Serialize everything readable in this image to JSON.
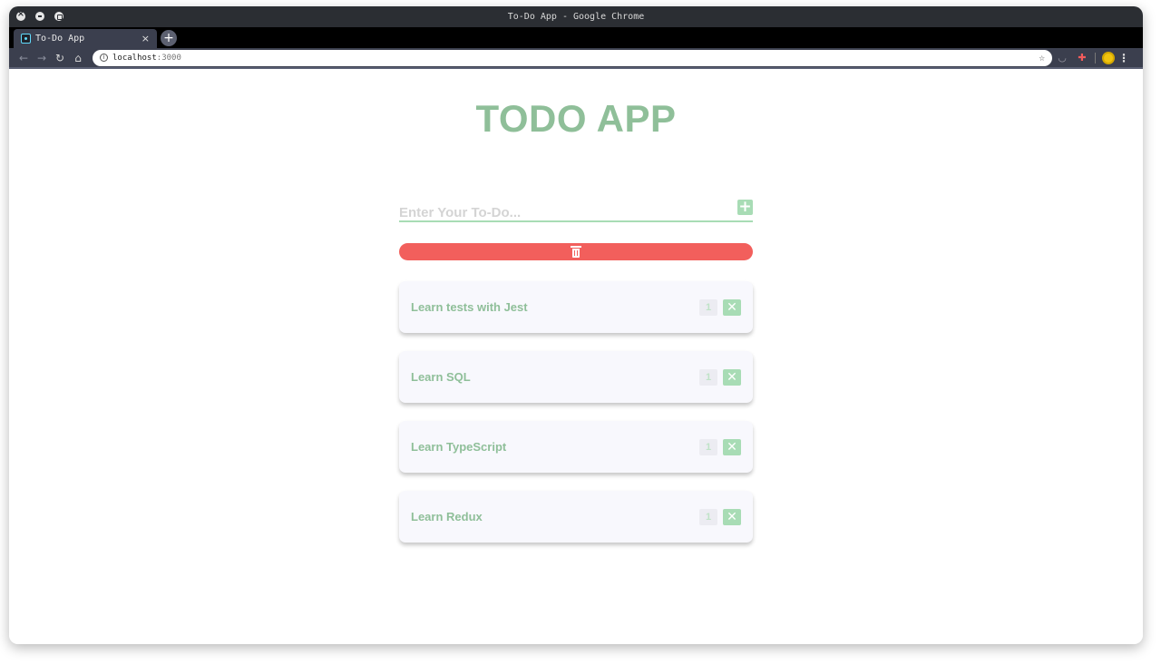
{
  "browser": {
    "window_title": "To-Do App - Google Chrome",
    "tab_title": "To-Do App",
    "url_host": "localhost",
    "url_port": ":3000"
  },
  "app": {
    "title": "TODO APP",
    "input_placeholder": "Enter Your To-Do...",
    "add_icon": "plus-icon",
    "clear_icon": "trash-icon"
  },
  "todos": [
    {
      "text": "Learn tests with Jest",
      "count": "1"
    },
    {
      "text": "Learn SQL",
      "count": "1"
    },
    {
      "text": "Learn TypeScript",
      "count": "1"
    },
    {
      "text": "Learn Redux",
      "count": "1"
    }
  ],
  "colors": {
    "accent": "#8fbf99",
    "accent_light": "#a8dcb5",
    "danger": "#f25f5c",
    "card_bg": "#f8f8fd"
  }
}
